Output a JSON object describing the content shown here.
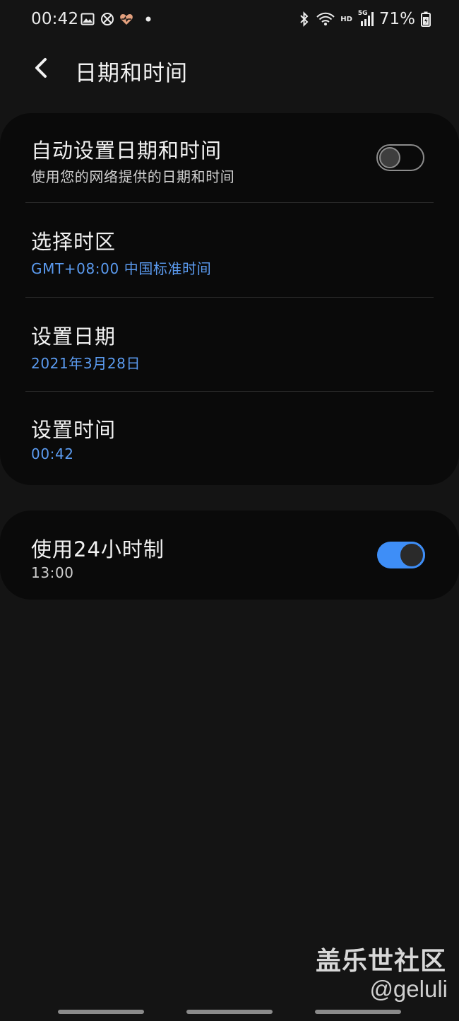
{
  "status_bar": {
    "time": "00:42",
    "battery": "71%",
    "icons_left": [
      "image-icon",
      "no-disturb-icon",
      "heart-icon",
      "dot-icon"
    ],
    "icons_right": [
      "bluetooth-icon",
      "wifi-icon",
      "hd-icon",
      "signal-5g-icon",
      "battery-icon"
    ],
    "hd_label": "HD",
    "fiveg_label": "5G"
  },
  "header": {
    "title": "日期和时间"
  },
  "card1": {
    "auto_set": {
      "title": "自动设置日期和时间",
      "subtitle": "使用您的网络提供的日期和时间",
      "enabled": false
    },
    "timezone": {
      "title": "选择时区",
      "value": "GMT+08:00 中国标准时间"
    },
    "set_date": {
      "title": "设置日期",
      "value": "2021年3月28日"
    },
    "set_time": {
      "title": "设置时间",
      "value": "00:42"
    }
  },
  "card2": {
    "use_24h": {
      "title": "使用24小时制",
      "subtitle": "13:00",
      "enabled": true
    }
  },
  "watermark": {
    "title": "盖乐世社区",
    "handle": "@geluli"
  },
  "colors": {
    "background": "#141414",
    "card": "#0a0a0a",
    "accent": "#3e8ef7",
    "link": "#5b9bf0"
  }
}
